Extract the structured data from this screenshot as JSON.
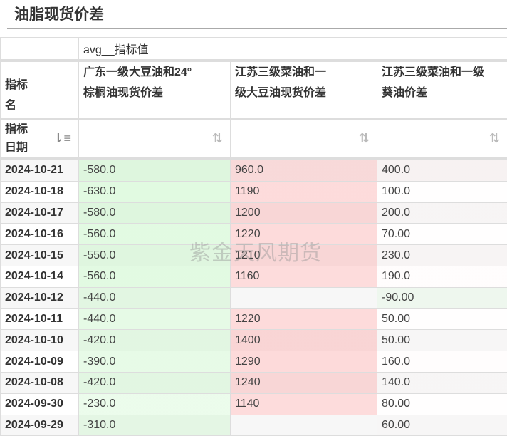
{
  "title": "油脂现货价差",
  "group_header": "avg__指标值",
  "row_header_name": "指标名",
  "row_header_date": "指标日期",
  "columns": [
    "广东一级大豆油和24°棕榈油现货价差",
    "江苏三级菜油和一级大豆油现货价差",
    "江苏三级菜油和一级葵油价差"
  ],
  "sort_icons": {
    "date": "sort-desc-icon",
    "columns": "sort-icon"
  },
  "watermark": "紫金天风期货",
  "colors": {
    "positive": "#fbcfcf",
    "negative": "#e2fbe2",
    "header_border": "#dddddd"
  },
  "rows": [
    {
      "date": "2024-10-21",
      "values": [
        "-580.0",
        "960.0",
        "400.0"
      ]
    },
    {
      "date": "2024-10-18",
      "values": [
        "-630.0",
        "1190",
        "100.0"
      ]
    },
    {
      "date": "2024-10-17",
      "values": [
        "-580.0",
        "1200",
        "200.0"
      ]
    },
    {
      "date": "2024-10-16",
      "values": [
        "-560.0",
        "1220",
        "70.00"
      ]
    },
    {
      "date": "2024-10-15",
      "values": [
        "-550.0",
        "1210",
        "230.0"
      ]
    },
    {
      "date": "2024-10-14",
      "values": [
        "-560.0",
        "1160",
        "190.0"
      ]
    },
    {
      "date": "2024-10-12",
      "values": [
        "-440.0",
        "",
        "-90.00"
      ]
    },
    {
      "date": "2024-10-11",
      "values": [
        "-440.0",
        "1220",
        "50.00"
      ]
    },
    {
      "date": "2024-10-10",
      "values": [
        "-420.0",
        "1400",
        "50.00"
      ]
    },
    {
      "date": "2024-10-09",
      "values": [
        "-390.0",
        "1290",
        "160.0"
      ]
    },
    {
      "date": "2024-10-08",
      "values": [
        "-420.0",
        "1240",
        "140.0"
      ]
    },
    {
      "date": "2024-09-30",
      "values": [
        "-230.0",
        "1140",
        "80.00"
      ]
    },
    {
      "date": "2024-09-29",
      "values": [
        "-310.0",
        "",
        "60.00"
      ]
    }
  ]
}
